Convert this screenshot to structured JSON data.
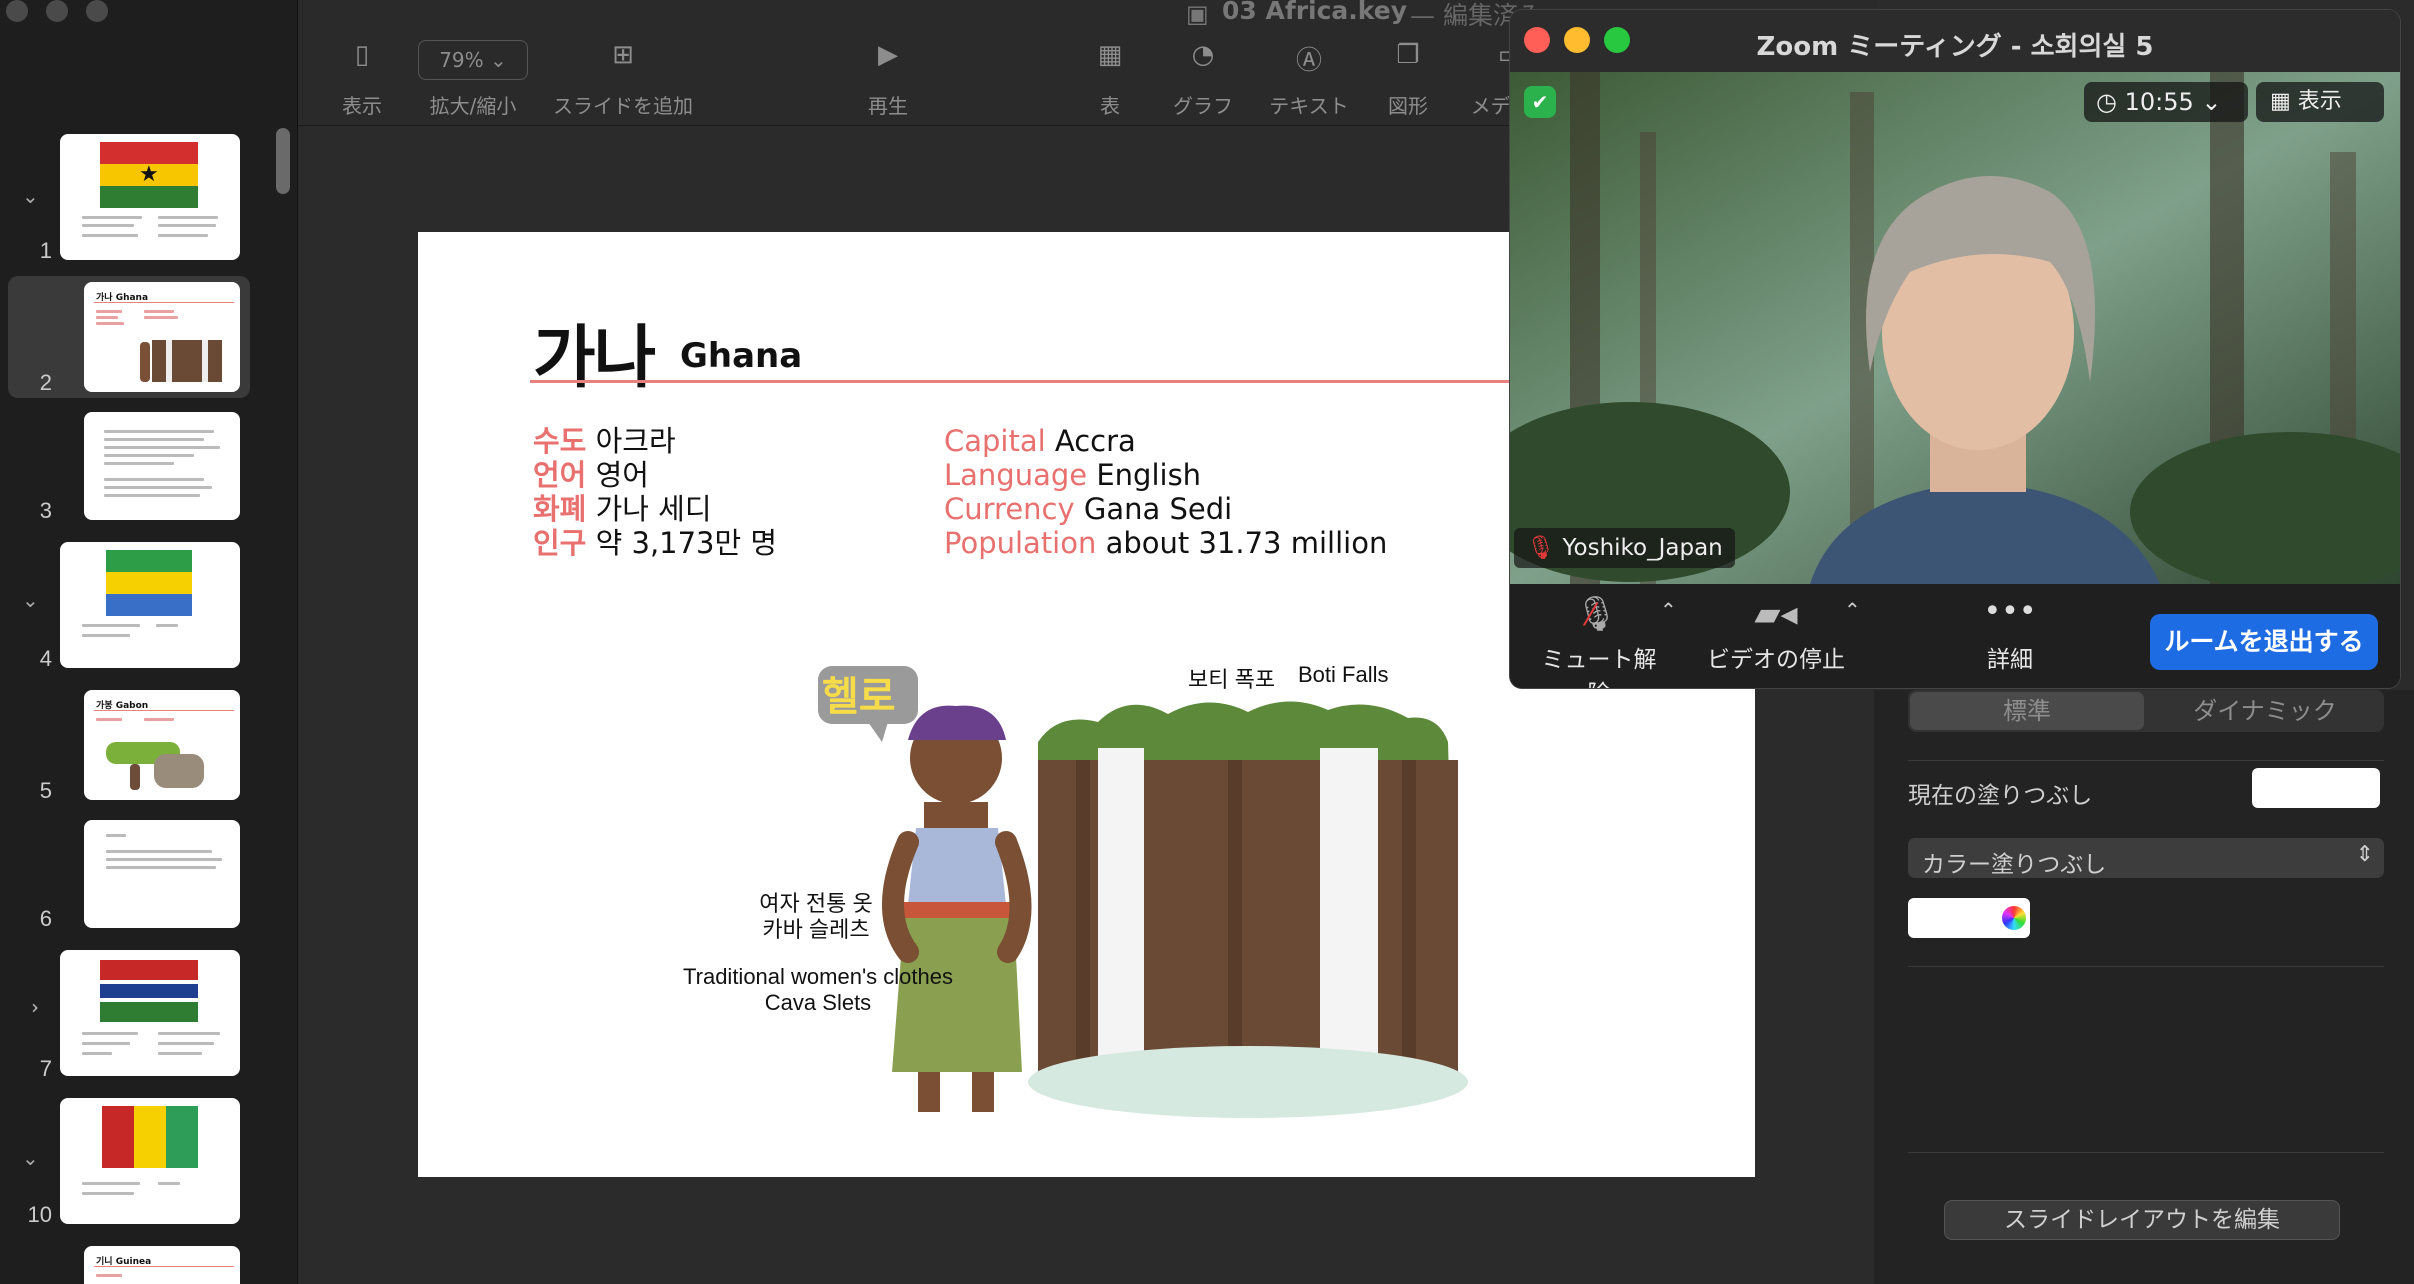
{
  "window": {
    "title": "03 Africa.key",
    "status": "— 編集済み"
  },
  "toolbar": {
    "view": "表示",
    "zoom_value": "79%",
    "zoom_label": "拡大/縮小",
    "add_slide": "スライドを追加",
    "play": "再生",
    "table": "表",
    "chart": "グラフ",
    "text": "テキスト",
    "shape": "図形",
    "media": "メディア"
  },
  "slides": [
    {
      "num": "1",
      "kind": "flag-ghana"
    },
    {
      "num": "2",
      "kind": "ghana-detail",
      "selected": true
    },
    {
      "num": "3",
      "kind": "text"
    },
    {
      "num": "4",
      "kind": "flag-gabon"
    },
    {
      "num": "5",
      "kind": "gabon-detail"
    },
    {
      "num": "6",
      "kind": "text"
    },
    {
      "num": "7",
      "kind": "flag-gambia"
    },
    {
      "num": "10",
      "kind": "flag-guinea"
    }
  ],
  "slide": {
    "title_ko": "가나",
    "title_en": "Ghana",
    "ko": [
      {
        "key": "수도",
        "value": "아크라"
      },
      {
        "key": "언어",
        "value": "영어"
      },
      {
        "key": "화폐",
        "value": "가나 세디"
      },
      {
        "key": "인구",
        "value": "약 3,173만 명"
      }
    ],
    "en": [
      {
        "key": "Capital",
        "value": "Accra"
      },
      {
        "key": "Language",
        "value": "English"
      },
      {
        "key": "Currency",
        "value": "Gana Sedi"
      },
      {
        "key": "Population",
        "value": "about 31.73 million"
      }
    ],
    "bubble": "헬로",
    "falls_ko": "보티 폭포",
    "falls_en": "Boti Falls",
    "clothes_ko_1": "여자 전통 옷",
    "clothes_ko_2": "카바 슬레츠",
    "clothes_en_1": "Traditional women's clothes",
    "clothes_en_2": "Cava Slets"
  },
  "inspector": {
    "seg_standard": "標準",
    "seg_dynamic": "ダイナミック",
    "current_fill": "現在の塗りつぶし",
    "fill_type": "カラー塗りつぶし",
    "edit_layout": "スライドレイアウトを編集"
  },
  "zoom": {
    "title": "Zoom ミーティング - 소회의실 5",
    "time": "10:55",
    "view_label": "表示",
    "participant": "Yoshiko_Japan",
    "unmute": "ミュート解除",
    "stop_video": "ビデオの停止",
    "more": "詳細",
    "leave": "ルームを退出する"
  },
  "colors": {
    "accent_red": "#e8716f",
    "zoom_blue": "#1d6ce4",
    "dark_bg": "#2b2b2b"
  }
}
